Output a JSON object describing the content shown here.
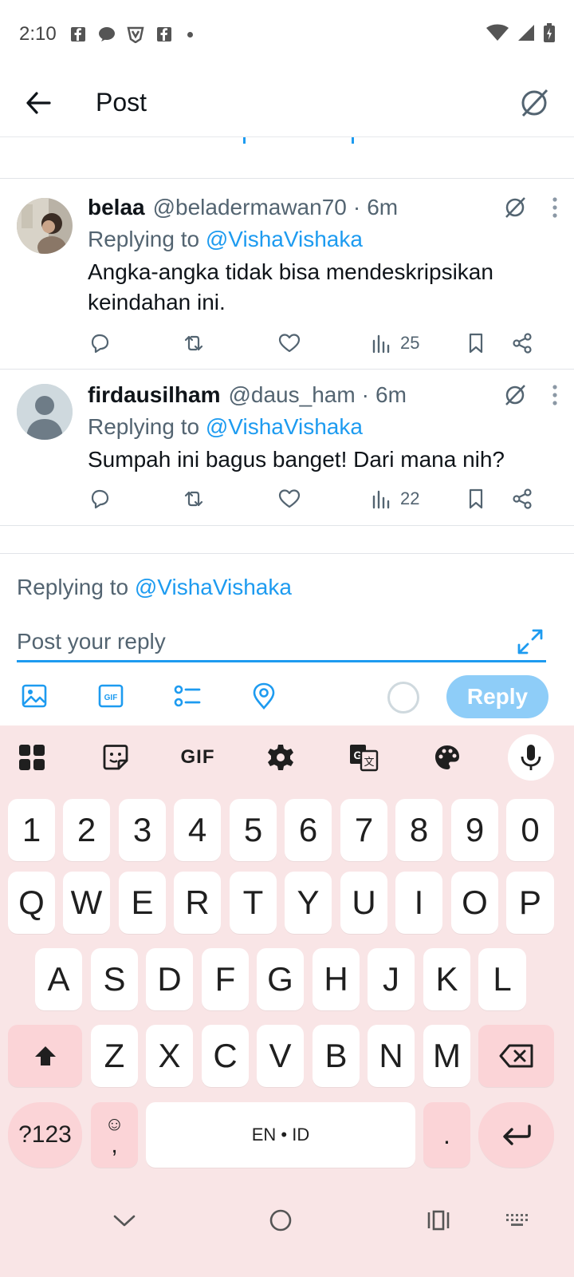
{
  "status_bar": {
    "time": "2:10"
  },
  "header": {
    "title": "Post"
  },
  "posts": [
    {
      "name": "belaa",
      "handle": "@beladermawan70",
      "time": "6m",
      "replying_prefix": "Replying to",
      "replying_to": "@VishaVishaka",
      "text": "Angka-angka tidak bisa mendeskripsikan keindahan ini.",
      "views": "25"
    },
    {
      "name": "firdausilham",
      "handle": "@daus_ham",
      "time": "6m",
      "replying_prefix": "Replying to",
      "replying_to": "@VishaVishaka",
      "text": "Sumpah ini bagus banget! Dari mana nih?",
      "views": "22"
    }
  ],
  "composer": {
    "replying_prefix": "Replying to",
    "replying_to": "@VishaVishaka",
    "placeholder": "Post your reply",
    "reply_label": "Reply"
  },
  "keyboard": {
    "number_row": [
      "1",
      "2",
      "3",
      "4",
      "5",
      "6",
      "7",
      "8",
      "9",
      "0"
    ],
    "row1": [
      "Q",
      "W",
      "E",
      "R",
      "T",
      "Y",
      "U",
      "I",
      "O",
      "P"
    ],
    "row2": [
      "A",
      "S",
      "D",
      "F",
      "G",
      "H",
      "J",
      "K",
      "L"
    ],
    "row3": [
      "Z",
      "X",
      "C",
      "V",
      "B",
      "N",
      "M"
    ],
    "symbols_label": "?123",
    "emoji_label": "☺",
    "comma_label": ",",
    "space_label": "EN • ID",
    "period_label": ".",
    "gif_label": "GIF"
  },
  "colors": {
    "accent": "#1d9bf0",
    "keyboard_bg": "#f9e5e6",
    "special_key": "#fbd4d7"
  }
}
